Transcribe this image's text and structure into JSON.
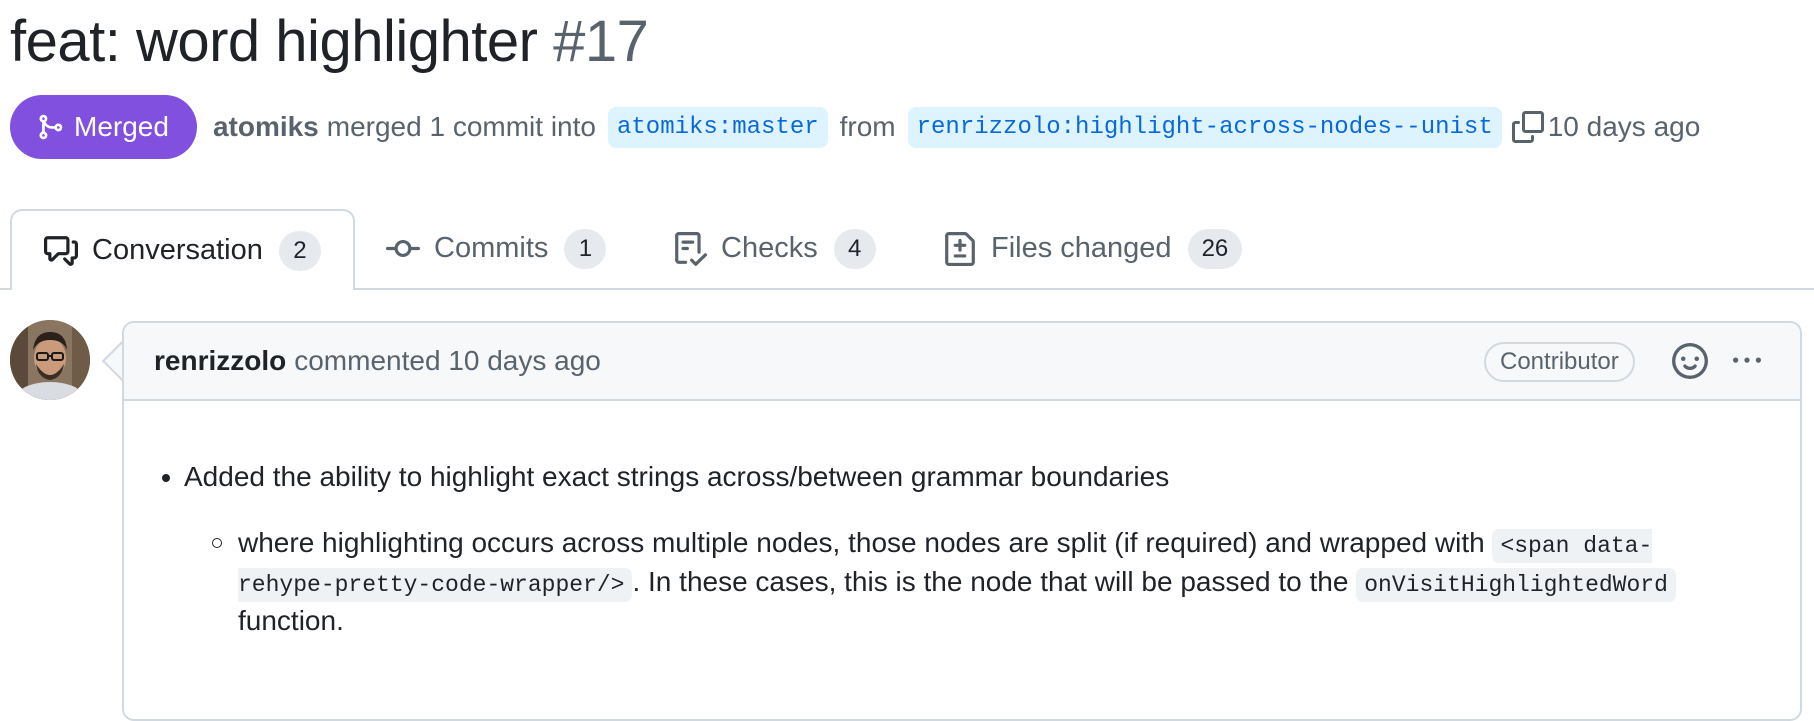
{
  "pr": {
    "title": "feat: word highlighter",
    "number": "#17",
    "status": "Merged",
    "author": "atomiks",
    "action": "merged 1 commit into",
    "base_branch": "atomiks:master",
    "from_label": "from",
    "head_branch": "renrizzolo:highlight-across-nodes--unist",
    "time": "10 days ago"
  },
  "tabs": [
    {
      "label": "Conversation",
      "count": "2",
      "icon": "comment-discussion-icon"
    },
    {
      "label": "Commits",
      "count": "1",
      "icon": "git-commit-icon"
    },
    {
      "label": "Checks",
      "count": "4",
      "icon": "checklist-icon"
    },
    {
      "label": "Files changed",
      "count": "26",
      "icon": "file-diff-icon"
    }
  ],
  "comment": {
    "author": "renrizzolo",
    "action": "commented",
    "time": "10 days ago",
    "role": "Contributor",
    "bullet1": "Added the ability to highlight exact strings across/between grammar boundaries",
    "bullet2_part1": "where highlighting occurs across multiple nodes, those nodes are split (if required) and wrapped with ",
    "bullet2_code1": "<span data-rehype-pretty-code-wrapper/>",
    "bullet2_part2": ". In these cases, this is the node that will be passed to the ",
    "bullet2_code2": "onVisitHighlightedWord",
    "bullet2_part3": " function."
  },
  "colors": {
    "merged": "#8250df",
    "branch_bg": "#ddf4ff",
    "branch_text": "#0969da",
    "border": "#d1d9e0"
  }
}
